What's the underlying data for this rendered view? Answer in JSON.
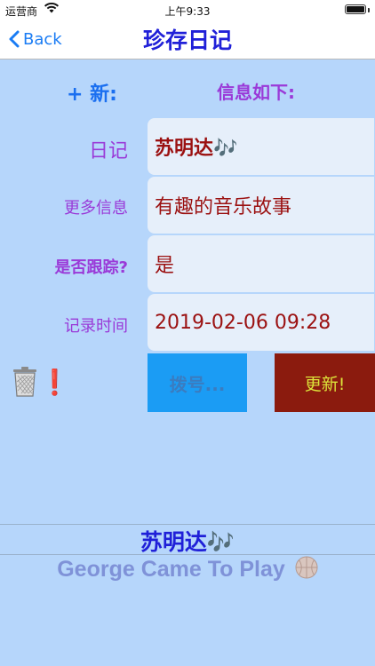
{
  "status_bar": {
    "carrier": "运营商",
    "time": "上午9:33",
    "battery_level": 1.0
  },
  "nav": {
    "back_label": "Back",
    "title": "珍存日记"
  },
  "header": {
    "new_label": "+ 新:",
    "info_label": "信息如下:"
  },
  "fields": {
    "diary": {
      "label": "日记",
      "value": "苏明达🎶"
    },
    "more_info": {
      "label": "更多信息",
      "value": "有趣的音乐故事"
    },
    "tracking": {
      "label": "是否跟踪?",
      "value": "是"
    },
    "record_time": {
      "label": "记录时间",
      "value": "2019-02-06 09:28"
    }
  },
  "actions": {
    "trash_icon": "trash-icon",
    "alert_mark": "❗",
    "dial_label": "拨号...",
    "update_label": "更新!"
  },
  "footer": {
    "title": "苏明达🎶",
    "subtitle": "George Came To Play",
    "subtitle_icon": "basketball-icon"
  },
  "colors": {
    "background": "#b6d6fb",
    "accent_blue": "#1a7cf4",
    "title_blue": "#2020d8",
    "label_purple": "#9a3ad8",
    "value_red": "#9b1111",
    "dial_bg": "#1b9cf4",
    "update_bg": "#8b1b0e",
    "update_text": "#dce33a"
  }
}
